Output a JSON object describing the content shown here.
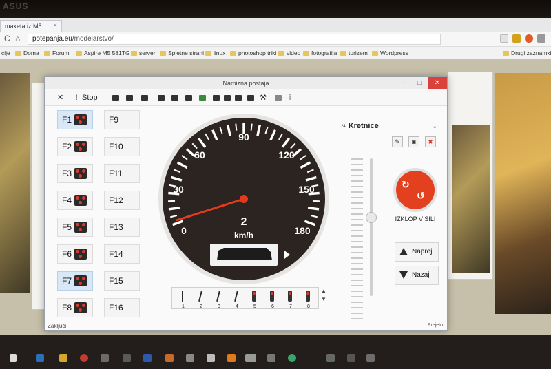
{
  "monitor": {
    "brand": "ASUS"
  },
  "browser": {
    "tab_title": "maketa iz M5",
    "url_host": "potepanja.eu",
    "url_path": "/modelarstvo/",
    "bookmarks": [
      "cije",
      "Doma",
      "Forumi",
      "Aspire M5 581TG",
      "server",
      "Spletne strani",
      "linux",
      "photoshop triki",
      "video",
      "fotografija",
      "turizem",
      "Wordpress"
    ],
    "bookmark_right": "Drugi zaznamki"
  },
  "app": {
    "window_title": "Namizna postaja",
    "stop_label": "Stop",
    "function_keys_left": [
      {
        "label": "F1",
        "active": true
      },
      {
        "label": "F2",
        "active": false
      },
      {
        "label": "F3",
        "active": false
      },
      {
        "label": "F4",
        "active": false
      },
      {
        "label": "F5",
        "active": false
      },
      {
        "label": "F6",
        "active": false
      },
      {
        "label": "F7",
        "active": true
      },
      {
        "label": "F8",
        "active": false
      }
    ],
    "function_keys_right": [
      "F9",
      "F10",
      "F11",
      "F12",
      "F13",
      "F14",
      "F15",
      "F16"
    ],
    "speedometer": {
      "tick_labels": [
        "0",
        "30",
        "60",
        "90",
        "120",
        "150",
        "180"
      ],
      "current_speed": "2",
      "unit": "km/h",
      "max": 180,
      "value": 2
    },
    "accessory_selector": {
      "number": "24",
      "label": "Kretnice"
    },
    "emergency_label": "IZKLOP V SILI",
    "forward_label": "Naprej",
    "reverse_label": "Nazaj",
    "turnout_labels": [
      "1",
      "2",
      "3",
      "4",
      "5",
      "6",
      "7",
      "8"
    ],
    "status_left": "Zaključi",
    "status_right": "Prejeto"
  },
  "colors": {
    "accent_red": "#e2401f",
    "signal_red": "#d93a2e",
    "dial": "#2b2420"
  }
}
